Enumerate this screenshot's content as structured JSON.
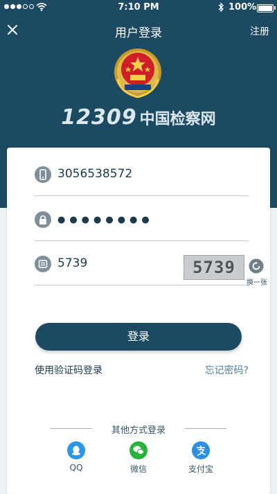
{
  "status_bar": {
    "time": "7:10 PM",
    "battery": "100%",
    "signal_bars": 3,
    "battery_level": 1.0
  },
  "nav": {
    "title": "用户登录",
    "register_label": "注册"
  },
  "brand": {
    "number": "12309",
    "name": "中国检察网"
  },
  "form": {
    "phone_value": "3056538572",
    "password_masked": "●●●●●●●●",
    "captcha_input": "5739",
    "captcha_image_text": "5739",
    "refresh_label": "换一张",
    "login_button": "登录",
    "sms_login_link": "使用验证码登录",
    "forgot_link": "忘记密码?"
  },
  "other_login": {
    "title": "其他方式登录",
    "options": [
      {
        "label": "QQ",
        "color": "#2e96e8",
        "icon": "qq-icon"
      },
      {
        "label": "微信",
        "color": "#28b43c",
        "icon": "wechat-icon"
      },
      {
        "label": "支付宝",
        "color": "#2d8fe0",
        "icon": "alipay-icon"
      }
    ]
  },
  "colors": {
    "header": "#1b4a62",
    "primary_button": "#1b4a62",
    "link": "#4f7f98"
  }
}
